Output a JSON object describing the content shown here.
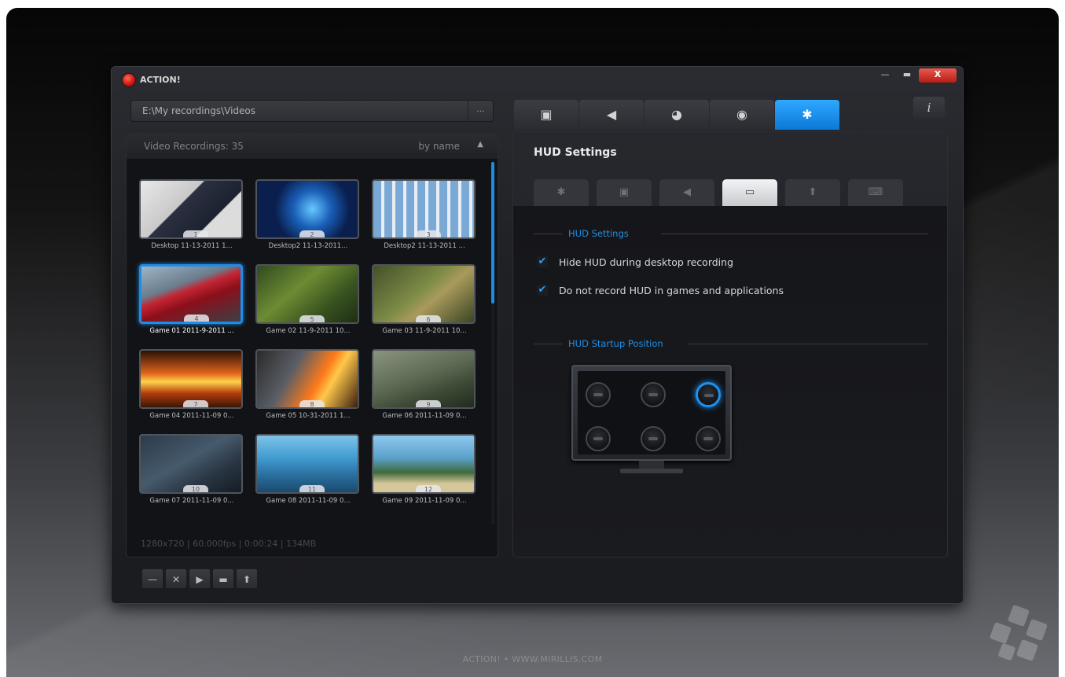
{
  "window": {
    "title": "ACTION!",
    "controls": {
      "minimize": "—",
      "maximize": "▬",
      "close": "X"
    }
  },
  "path_bar": {
    "value": "E:\\My recordings\\Videos",
    "browse_label": "..."
  },
  "recordings": {
    "header": "Video Recordings: 35",
    "sort_label": "by name",
    "sort_arrow": "▲",
    "status": "1280x720 | 60.000fps | 0:00:24 | 134MB",
    "items": [
      {
        "number": "1",
        "caption": "Desktop 11-13-2011 1..."
      },
      {
        "number": "2",
        "caption": "Desktop2 11-13-2011..."
      },
      {
        "number": "3",
        "caption": "Desktop2 11-13-2011 ..."
      },
      {
        "number": "4",
        "caption": "Game 01 2011-9-2011 ..."
      },
      {
        "number": "5",
        "caption": "Game 02 11-9-2011 10..."
      },
      {
        "number": "6",
        "caption": "Game 03 11-9-2011 10..."
      },
      {
        "number": "7",
        "caption": "Game 04 2011-11-09 0..."
      },
      {
        "number": "8",
        "caption": "Game 05 10-31-2011 1..."
      },
      {
        "number": "9",
        "caption": "Game 06 2011-11-09 0..."
      },
      {
        "number": "10",
        "caption": "Game 07 2011-11-09 0..."
      },
      {
        "number": "11",
        "caption": "Game 08 2011-11-09 0..."
      },
      {
        "number": "12",
        "caption": "Game 09 2011-11-09 0..."
      }
    ],
    "selected_number": "4",
    "tools": [
      {
        "icon": "minus-icon",
        "glyph": "—"
      },
      {
        "icon": "delete-icon",
        "glyph": "✕"
      },
      {
        "icon": "play-icon",
        "glyph": "▶"
      },
      {
        "icon": "folder-icon",
        "glyph": "▬"
      },
      {
        "icon": "upload-icon",
        "glyph": "⬆"
      }
    ]
  },
  "main_tabs": [
    {
      "icon": "film-icon",
      "glyph": "▣"
    },
    {
      "icon": "speaker-icon",
      "glyph": "◀"
    },
    {
      "icon": "stopwatch-icon",
      "glyph": "◕"
    },
    {
      "icon": "camera-icon",
      "glyph": "◉"
    },
    {
      "icon": "settings-icon",
      "glyph": "✱",
      "active": true
    }
  ],
  "info_label": "i",
  "settings": {
    "title": "HUD Settings",
    "sub_tabs": [
      {
        "icon": "gear-icon",
        "glyph": "✱"
      },
      {
        "icon": "film-icon",
        "glyph": "▣"
      },
      {
        "icon": "speaker-icon",
        "glyph": "◀"
      },
      {
        "icon": "hud-monitor-icon",
        "glyph": "▭",
        "active": true
      },
      {
        "icon": "upload-icon",
        "glyph": "⬆"
      },
      {
        "icon": "keyboard-icon",
        "glyph": "⌨"
      }
    ],
    "hud_section_label": "HUD Settings",
    "options": [
      {
        "label": "Hide HUD during desktop recording",
        "checked": true
      },
      {
        "label": "Do not record HUD in games and applications",
        "checked": true
      }
    ],
    "position_section_label": "HUD Startup Position",
    "positions": [
      "top-left",
      "top-center",
      "top-right",
      "bottom-left",
      "bottom-center",
      "bottom-right"
    ],
    "selected_position": "top-right"
  },
  "footer": "ACTION!  •  WWW.MIRILLIS.COM",
  "colors": {
    "accent": "#1e8fe6",
    "close": "#d0160d"
  }
}
